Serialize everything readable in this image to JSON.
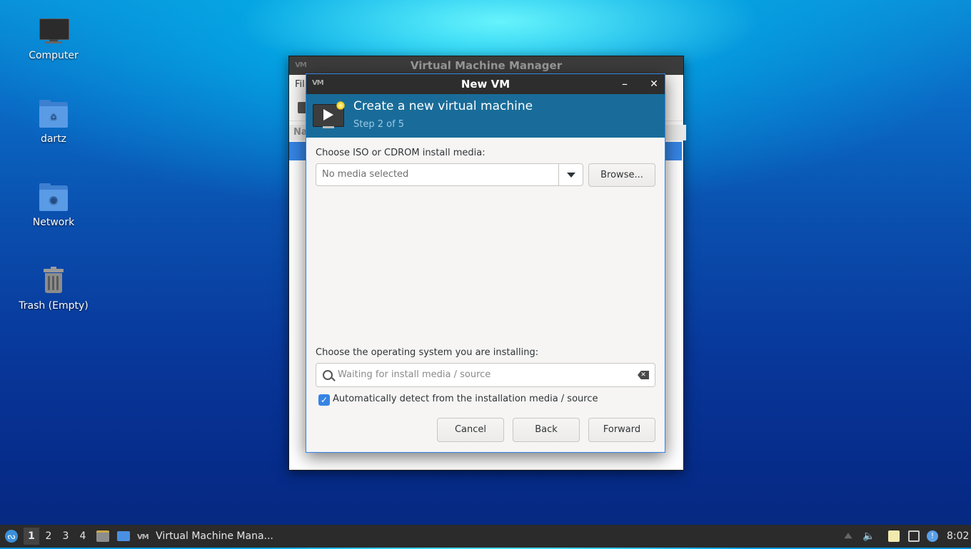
{
  "desktop": {
    "icons": [
      {
        "label": "Computer"
      },
      {
        "label": "dartz"
      },
      {
        "label": "Network"
      },
      {
        "label": "Trash (Empty)"
      }
    ]
  },
  "vmm_window": {
    "title": "Virtual Machine Manager",
    "menu_first": "Fil",
    "list_header": "Na"
  },
  "dialog": {
    "title": "New VM",
    "minimize": "–",
    "close": "✕",
    "banner_title": "Create a new virtual machine",
    "banner_step": "Step 2 of 5",
    "media_label": "Choose ISO or CDROM install media:",
    "media_value": "No media selected",
    "browse_label": "Browse...",
    "os_label": "Choose the operating system you are installing:",
    "os_placeholder": "Waiting for install media / source",
    "auto_detect_label": "Automatically detect from the installation media / source",
    "auto_detect_checked": true,
    "cancel_label": "Cancel",
    "back_label": "Back",
    "forward_label": "Forward"
  },
  "taskbar": {
    "workspaces": [
      "1",
      "2",
      "3",
      "4"
    ],
    "active_workspace": "1",
    "task_label": "Virtual Machine Mana...",
    "clock": "8:02"
  }
}
